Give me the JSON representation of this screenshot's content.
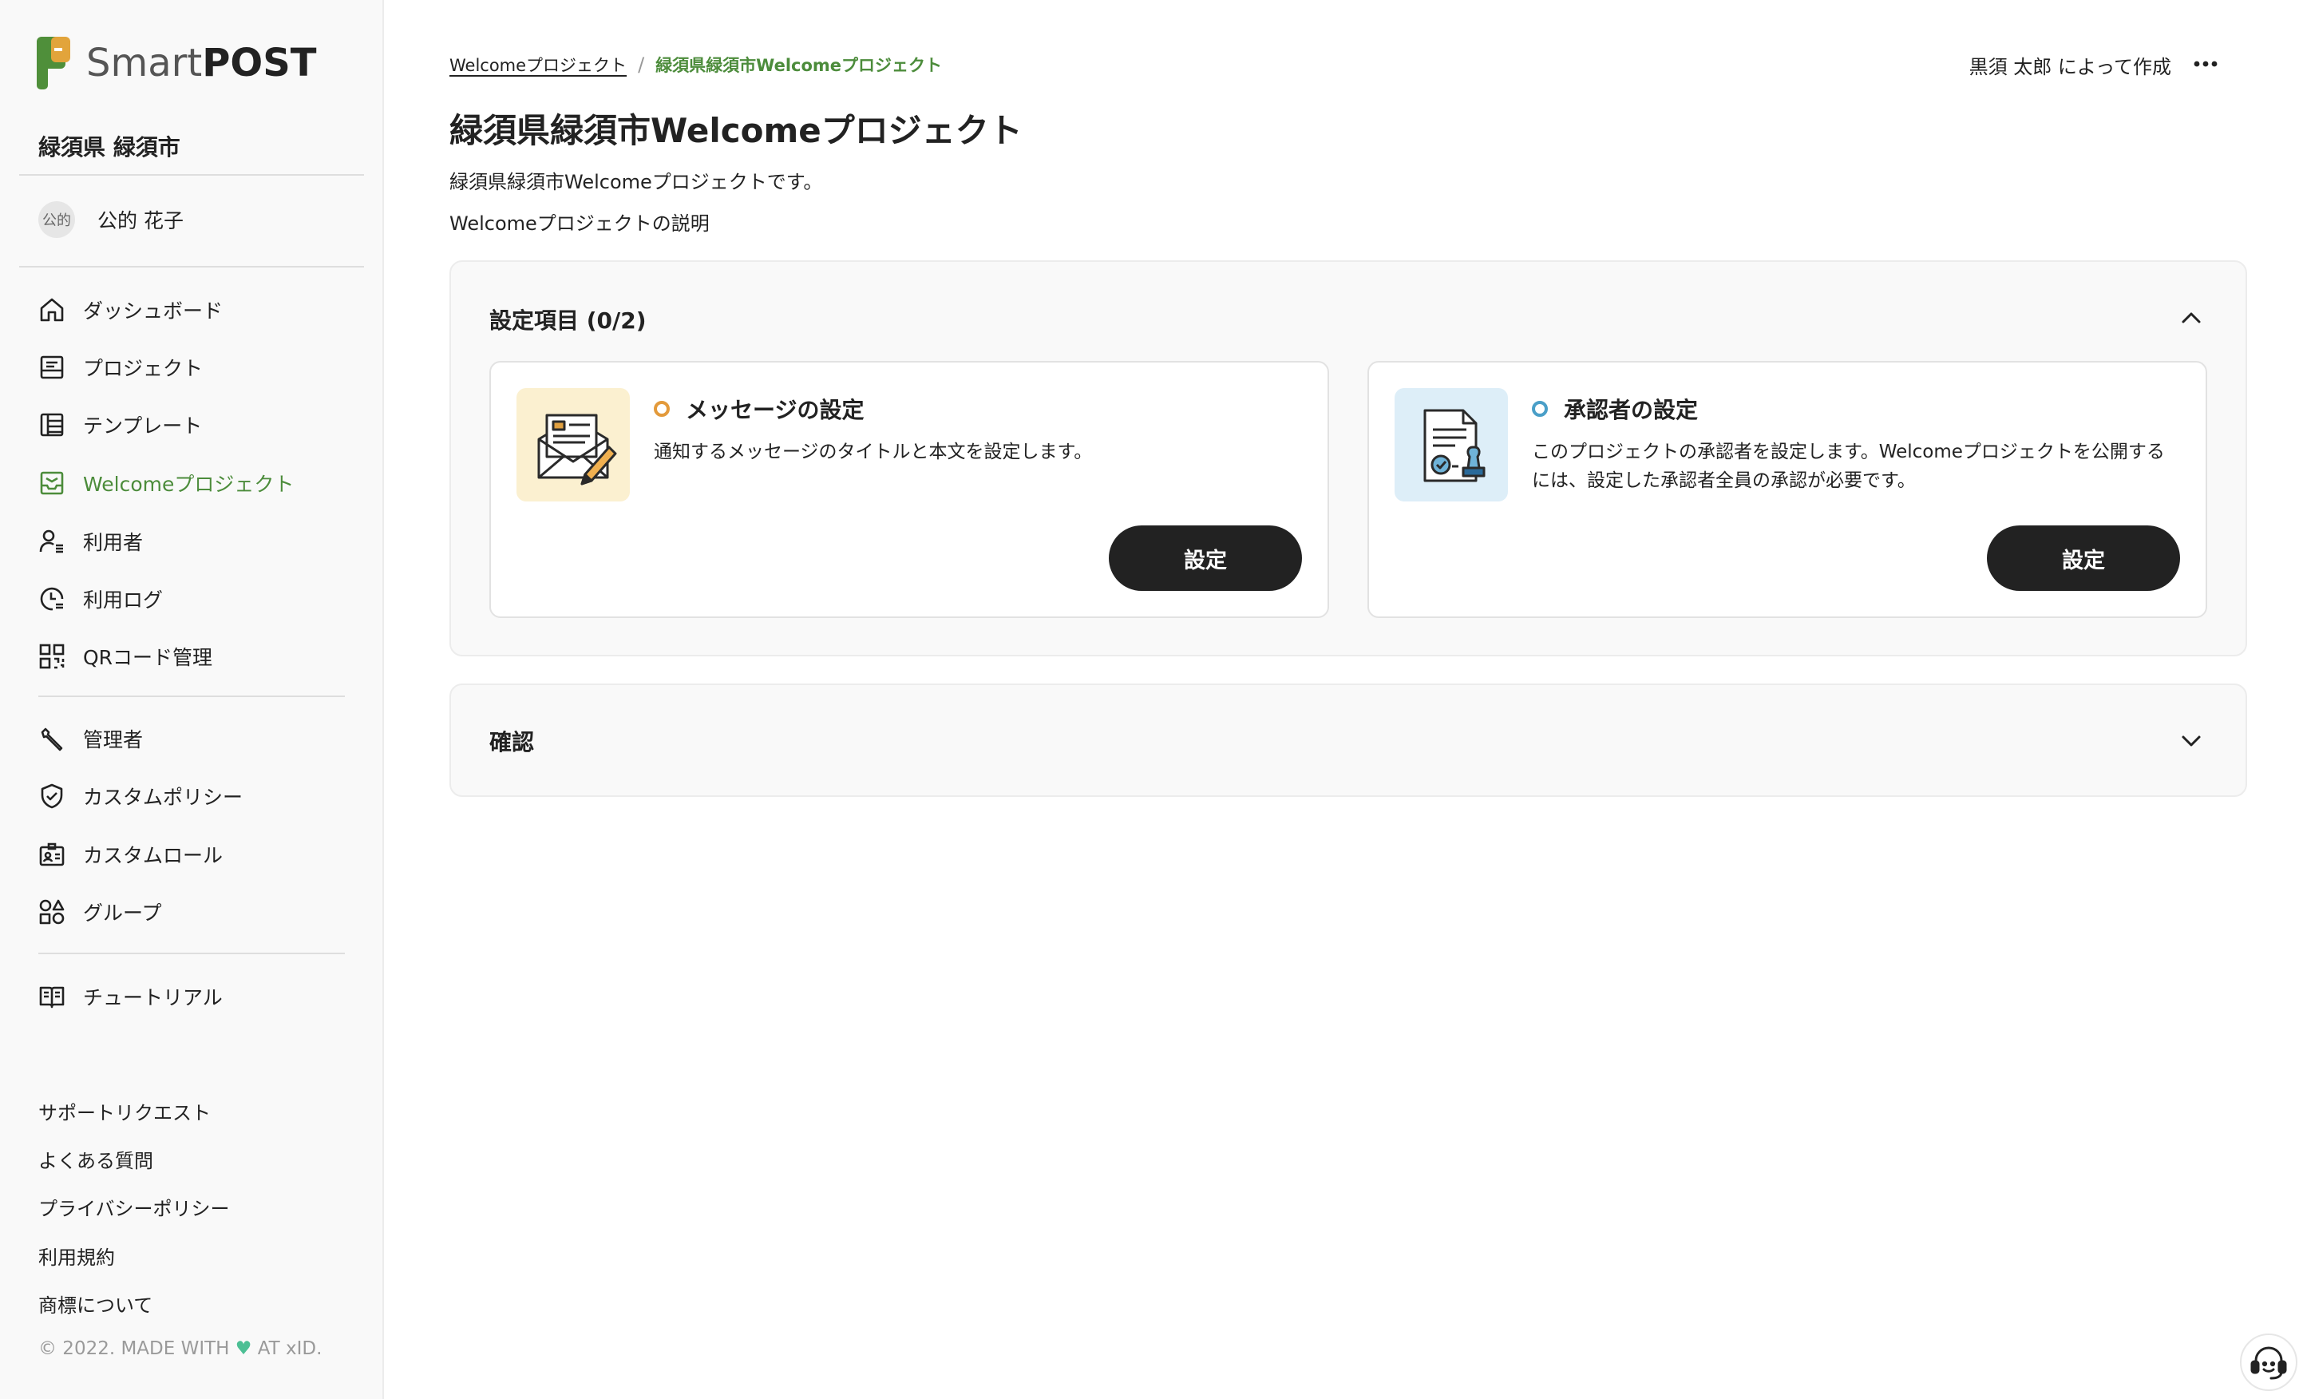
{
  "brand": {
    "name_light": "Smart",
    "name_bold": "POST"
  },
  "sidebar": {
    "org_name": "緑須県 緑須市",
    "user": {
      "avatar_text": "公的",
      "name": "公的 花子"
    },
    "nav_main": [
      {
        "label": "ダッシュボード",
        "icon": "home-icon"
      },
      {
        "label": "プロジェクト",
        "icon": "project-icon"
      },
      {
        "label": "テンプレート",
        "icon": "template-icon"
      },
      {
        "label": "Welcomeプロジェクト",
        "icon": "welcome-inbox-icon",
        "active": true
      },
      {
        "label": "利用者",
        "icon": "user-list-icon"
      },
      {
        "label": "利用ログ",
        "icon": "log-clock-icon"
      },
      {
        "label": "QRコード管理",
        "icon": "qr-code-icon"
      }
    ],
    "nav_admin": [
      {
        "label": "管理者",
        "icon": "wrench-icon"
      },
      {
        "label": "カスタムポリシー",
        "icon": "shield-check-icon"
      },
      {
        "label": "カスタムロール",
        "icon": "id-card-icon"
      },
      {
        "label": "グループ",
        "icon": "shapes-icon"
      }
    ],
    "nav_help": [
      {
        "label": "チュートリアル",
        "icon": "book-icon"
      }
    ],
    "footer_links": [
      "サポートリクエスト",
      "よくある質問",
      "プライバシーポリシー",
      "利用規約",
      "商標について"
    ],
    "copyright_prefix": "© 2022. MADE WITH",
    "copyright_suffix": "AT xID."
  },
  "breadcrumb": {
    "parent": "Welcomeプロジェクト",
    "separator": "/",
    "current": "緑須県緑須市Welcomeプロジェクト"
  },
  "header": {
    "created_by": "黒須 太郎 によって作成"
  },
  "page": {
    "title": "緑須県緑須市Welcomeプロジェクト",
    "description": "緑須県緑須市Welcomeプロジェクトです。",
    "explanation": "Welcomeプロジェクトの説明"
  },
  "settings_panel": {
    "title": "設定項目 (0/2)",
    "expanded": true,
    "cards": [
      {
        "title": "メッセージの設定",
        "description": "通知するメッセージのタイトルと本文を設定します。",
        "button": "設定",
        "status_color": "#e39a3b",
        "image_bg": "#fbf0d0",
        "image": "envelope-pencil-illustration"
      },
      {
        "title": "承認者の設定",
        "description": "このプロジェクトの承認者を設定します。Welcomeプロジェクトを公開するには、設定した承認者全員の承認が必要です。",
        "button": "設定",
        "status_color": "#4a9fc8",
        "image_bg": "#ddeef8",
        "image": "document-stamp-illustration"
      }
    ]
  },
  "confirm_panel": {
    "title": "確認",
    "expanded": false
  },
  "colors": {
    "accent_green": "#4c8c3b",
    "button_dark": "#222222",
    "heart": "#4cbf94"
  }
}
